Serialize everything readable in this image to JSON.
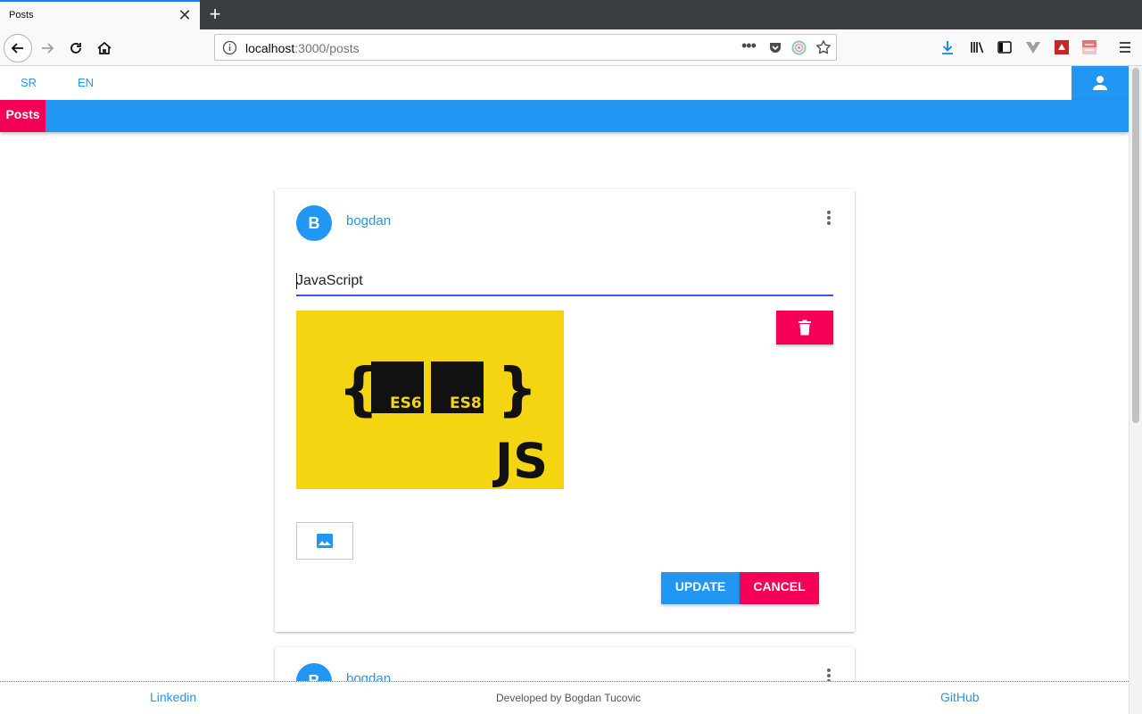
{
  "browser": {
    "tab_title": "Posts",
    "url_host": "localhost",
    "url_path": ":3000/posts"
  },
  "app": {
    "languages": [
      "SR",
      "EN"
    ],
    "nav_tab": "Posts",
    "accent_color": "#2196f3",
    "secondary_color": "#f50057"
  },
  "posts": [
    {
      "avatar_letter": "B",
      "author": "bogdan",
      "title_value": "JavaScript",
      "image": {
        "braces_left": "{",
        "braces_right": "}",
        "badge1": "ES6",
        "badge2": "ES8",
        "logo": "JS"
      },
      "buttons": {
        "update": "UPDATE",
        "cancel": "CANCEL"
      }
    },
    {
      "avatar_letter": "B",
      "author": "bogdan"
    }
  ],
  "footer": {
    "left_link": "Linkedin",
    "credit": "Developed by Bogdan Tucovic",
    "right_link": "GitHub"
  }
}
